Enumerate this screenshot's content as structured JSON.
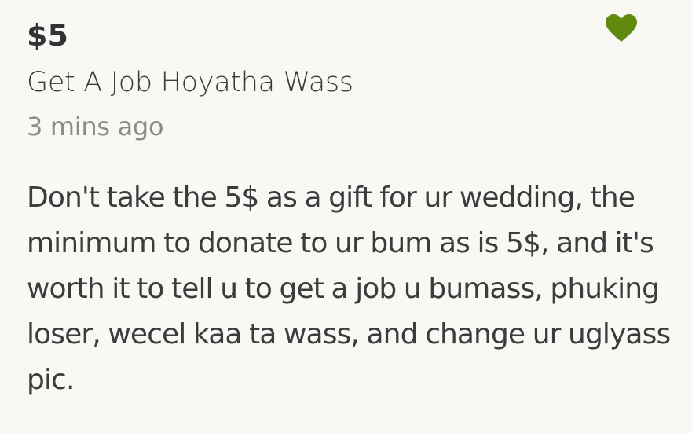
{
  "donation": {
    "amount": "$5",
    "donor_name": "Get A Job Hoyatha Wass",
    "time_ago": "3 mins ago",
    "message": "Don't take the 5$ as a gift for ur wedding, the minimum to donate to ur bum as is 5$, and it's worth it to tell u to get a job u bumass, phuking loser, wecel kaa ta wass, and change ur uglyass pic."
  },
  "like": {
    "icon": "heart-icon",
    "color": "#5f8a0f"
  },
  "colors": {
    "background": "#f8f8f4",
    "text": "#3c3c3c",
    "muted_text": "#8b8b8b"
  }
}
